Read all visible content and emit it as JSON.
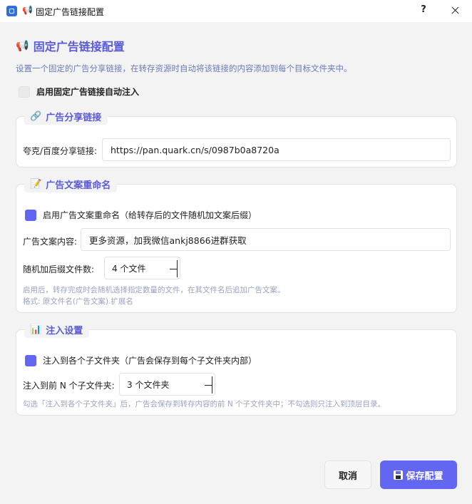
{
  "window": {
    "title": "固定广告链接配置",
    "title_icon": "megaphone-icon",
    "help": "?",
    "close": "close-icon"
  },
  "header": {
    "icon": "📢",
    "title": "固定广告链接配置",
    "description": "设置一个固定的广告分享链接，在转存资源时自动将该链接的内容添加到每个目标文件夹中。"
  },
  "enable_injection": {
    "label": "启用固定广告链接自动注入",
    "checked": false
  },
  "share_link_group": {
    "icon": "🔗",
    "title": "广告分享链接",
    "field_label": "夸克/百度分享链接:",
    "value": "https://pan.quark.cn/s/0987b0a8720a"
  },
  "rename_group": {
    "icon": "📝",
    "title": "广告文案重命名",
    "enable_label": "启用广告文案重命名（给转存后的文件随机加文案后缀）",
    "enable_checked": true,
    "content_label": "广告文案内容:",
    "content_value": "更多资源，加我微信ankj8866进群获取",
    "count_label": "随机加后缀文件数:",
    "count_value": "4 个文件",
    "hint_line1": "启用后，转存完成时会随机选择指定数量的文件，在其文件名后追加广告文案。",
    "hint_line2": "格式: 原文件名(广告文案).扩展名"
  },
  "inject_group": {
    "icon": "📊",
    "title": "注入设置",
    "enable_label": "注入到各个子文件夹（广告会保存到每个子文件夹内部）",
    "enable_checked": true,
    "count_label": "注入到前 N 个子文件夹:",
    "count_value": "3 个文件夹",
    "hint": "勾选「注入到各个子文件夹」后，广告会保存到转存内容的前 N 个子文件夹中；不勾选则只注入到顶层目录。"
  },
  "footer": {
    "cancel_label": "取消",
    "save_label": "保存配置"
  },
  "colors": {
    "accent": "#6366f1",
    "title_text": "#5b5bd6",
    "hint_text": "#9aa3c0"
  }
}
